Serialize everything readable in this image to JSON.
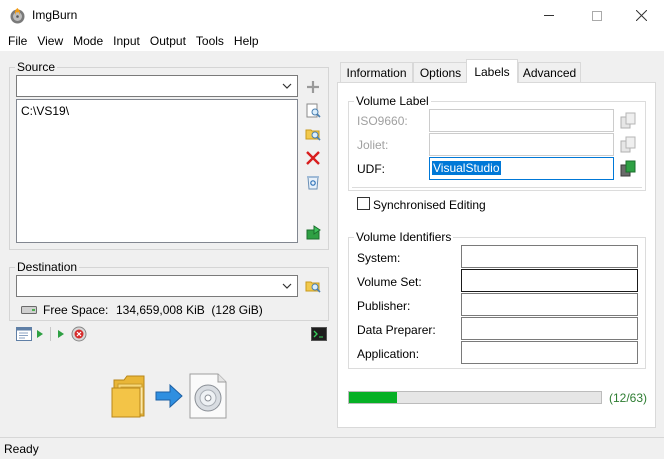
{
  "window": {
    "title": "ImgBurn",
    "minimize": "—",
    "maximize": "☐",
    "close": "✕"
  },
  "menu": [
    "File",
    "View",
    "Mode",
    "Input",
    "Output",
    "Tools",
    "Help"
  ],
  "source": {
    "label": "Source",
    "combo_value": "",
    "items": [
      "C:\\VS19\\"
    ]
  },
  "destination": {
    "label": "Destination",
    "combo_value": "",
    "free_space_label": "Free Space:",
    "free_space_value": "134,659,008 KiB  (128 GiB)"
  },
  "tabs": {
    "information": "Information",
    "options": "Options",
    "labels": "Labels",
    "advanced": "Advanced",
    "active": "Labels"
  },
  "volume_label": {
    "title": "Volume Label",
    "iso_label": "ISO9660:",
    "iso_value": "",
    "joliet_label": "Joliet:",
    "joliet_value": "",
    "udf_label": "UDF:",
    "udf_value": "VisualStudio",
    "sync_label": "Synchronised Editing",
    "sync_checked": false
  },
  "volume_identifiers": {
    "title": "Volume Identifiers",
    "fields": [
      {
        "label": "System:",
        "value": ""
      },
      {
        "label": "Volume Set:",
        "value": ""
      },
      {
        "label": "Publisher:",
        "value": ""
      },
      {
        "label": "Data Preparer:",
        "value": ""
      },
      {
        "label": "Application:",
        "value": ""
      }
    ]
  },
  "progress": {
    "text": "(12/63)",
    "fraction": 0.19,
    "color": "#06b025"
  },
  "status": {
    "text": "Ready"
  },
  "colors": {
    "selection": "#0078d7",
    "accent_green": "#2e7d32",
    "link_red": "#cc0000"
  },
  "icons": {
    "app": "imgburn-fire-icon",
    "add": "plus-icon",
    "browse_file": "browse-file-icon",
    "browse_folder": "browse-folder-icon",
    "remove": "red-x-icon",
    "clear": "recycle-bin-icon",
    "calculate": "green-arrow-icon",
    "log": "log-window-icon",
    "build": "folder-to-disc-icon"
  }
}
